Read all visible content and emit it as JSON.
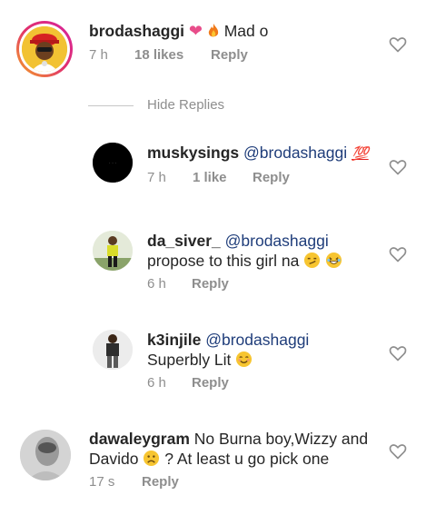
{
  "comments": [
    {
      "username": "brodashaggi",
      "text": "Mad o",
      "emojis": [
        "pink-heart",
        "fire"
      ],
      "time": "7 h",
      "likes": "18 likes",
      "reply": "Reply"
    },
    {
      "username": "muskysings",
      "mention": "@brodashaggi",
      "text": "",
      "emojis": [
        "hundred-points"
      ],
      "time": "7 h",
      "likes": "1 like",
      "reply": "Reply"
    },
    {
      "username": "da_siver_",
      "mention": "@brodashaggi",
      "text": "propose to this girl na",
      "emojis": [
        "smirk",
        "grin"
      ],
      "time": "6 h",
      "reply": "Reply"
    },
    {
      "username": "k3injile",
      "mention": "@brodashaggi",
      "text": "Superbly Lit",
      "emojis": [
        "blush"
      ],
      "time": "6 h",
      "reply": "Reply"
    },
    {
      "username": "dawaleygram",
      "text_line1": "No Burna boy,Wizzy and",
      "text_line2_a": "Davido",
      "text_line2_b": "? At least u go pick one",
      "emojis": [
        "frown"
      ],
      "time": "17 s",
      "reply": "Reply"
    }
  ],
  "hide_replies": "Hide Replies",
  "colors": {
    "text": "#262626",
    "meta": "#8e8e8e",
    "mention": "#1f3d7a",
    "story_ring_start": "#f5a623",
    "story_ring_end": "#d6249f"
  }
}
